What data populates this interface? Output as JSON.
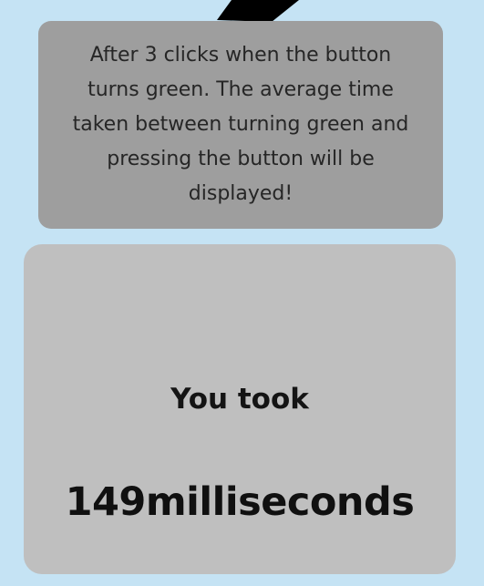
{
  "instructions": {
    "text": "After 3 clicks when the button\nturns green. The average time\ntaken between turning green and\npressing the button will be\ndisplayed!"
  },
  "result": {
    "label": "You took",
    "value": "149milliseconds"
  },
  "colors": {
    "background": "#c5e3f4",
    "info_card": "#9e9e9e",
    "result_card": "#bfbfbf",
    "text": "#141414"
  }
}
